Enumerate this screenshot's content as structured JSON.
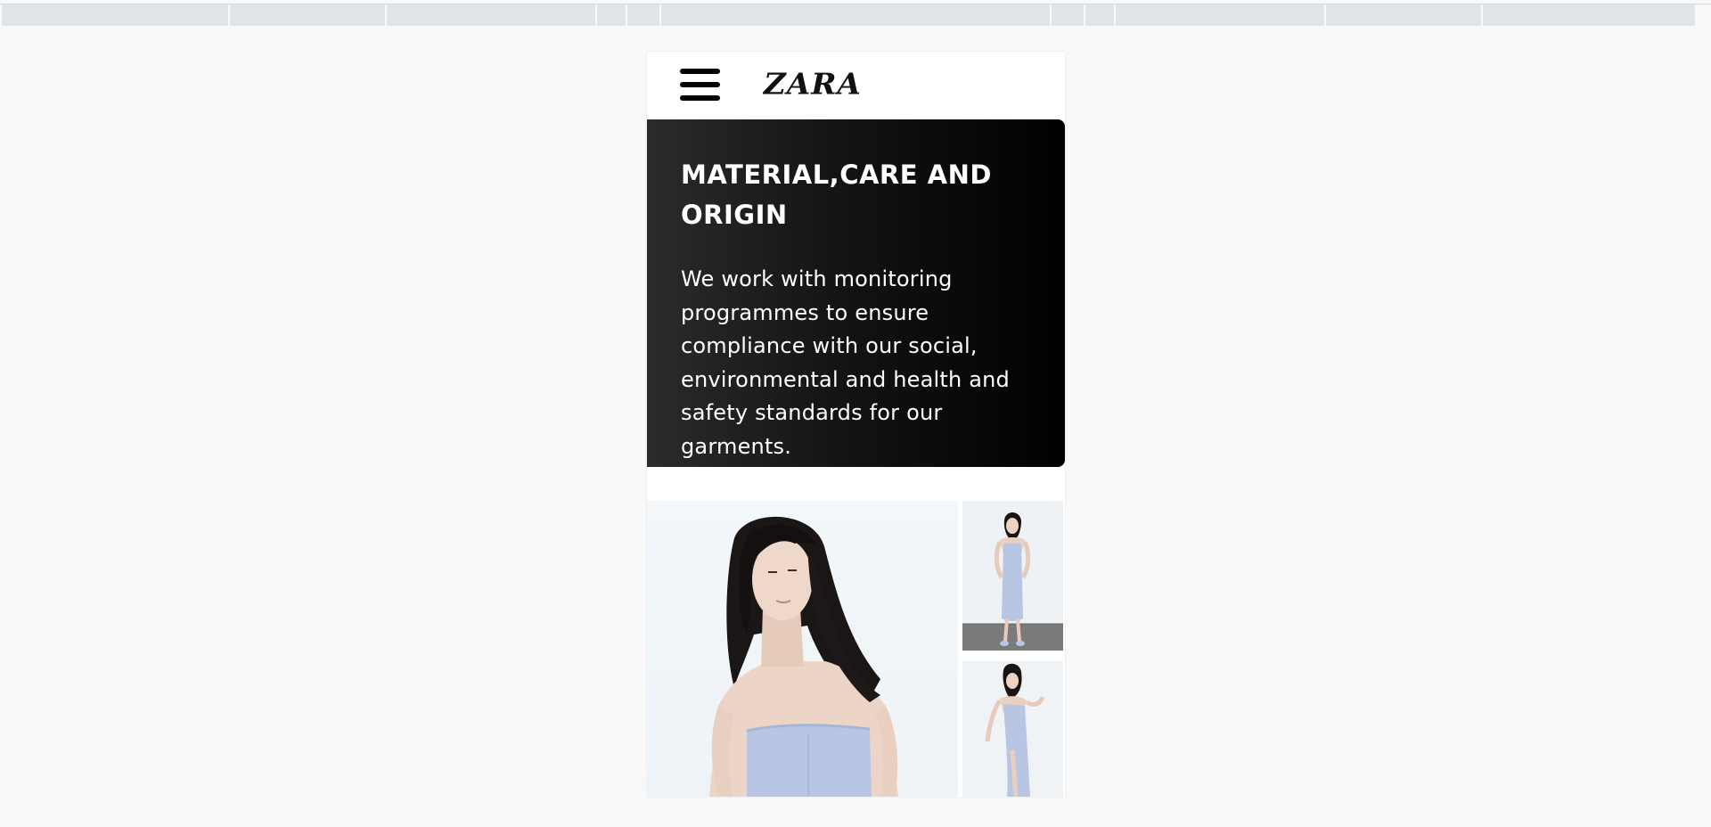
{
  "browser": {
    "tab_strip_segments": 12
  },
  "header": {
    "logo": "ZARA",
    "menu_icon": "hamburger-menu-icon"
  },
  "info_panel": {
    "title": "MATERIAL,CARE AND ORIGIN",
    "body": "We work with monitoring programmes to ensure compliance with our social, environmental and health and safety standards for our garments."
  },
  "gallery": {
    "images": [
      {
        "name": "product-photo-main"
      },
      {
        "name": "product-photo-full-length"
      },
      {
        "name": "product-photo-side-pose"
      }
    ]
  },
  "colors": {
    "page_background": "#f9f9f9",
    "panel_dark": "#000000",
    "dress": "#b8c6e4"
  }
}
